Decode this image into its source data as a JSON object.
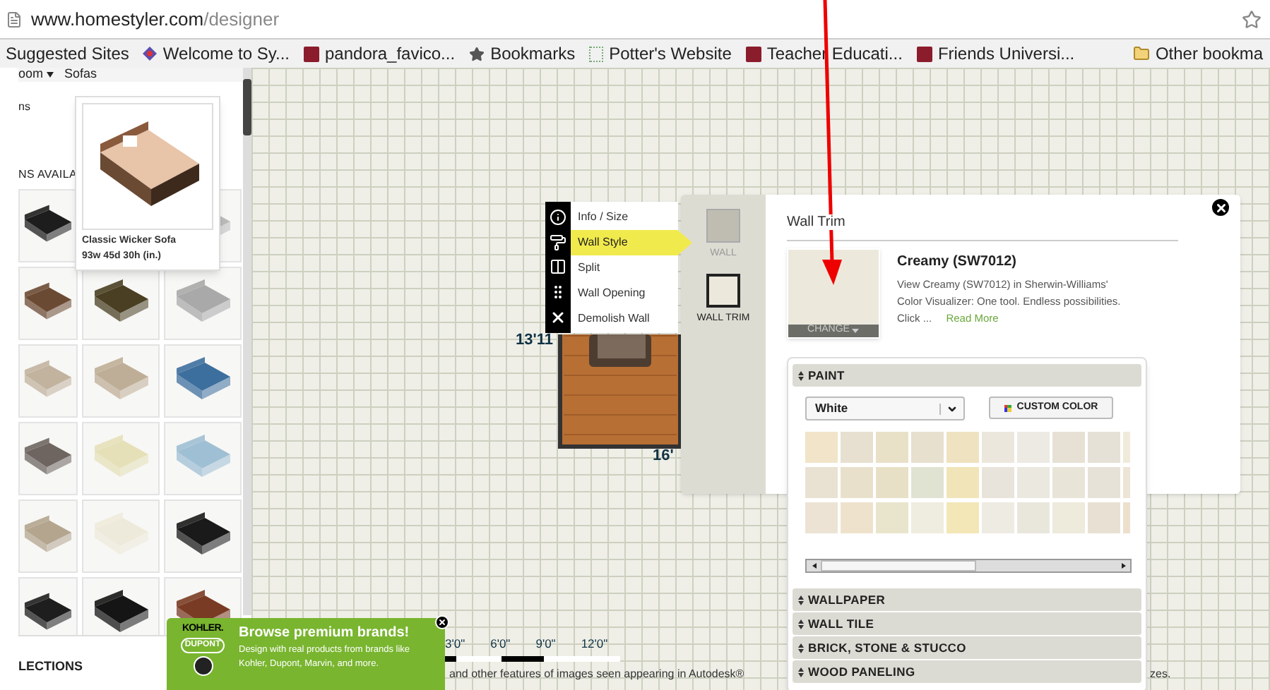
{
  "browser": {
    "url_host": "www.homestyler.com",
    "url_path": "/designer",
    "bookmarks": [
      {
        "label": "Suggested Sites",
        "kind": "plain"
      },
      {
        "label": "Welcome to Sy...",
        "kind": "site"
      },
      {
        "label": "pandora_favico...",
        "kind": "page"
      },
      {
        "label": "Bookmarks",
        "kind": "starred"
      },
      {
        "label": "Potter's Website",
        "kind": "blank"
      },
      {
        "label": "Teacher Educati...",
        "kind": "page"
      },
      {
        "label": "Friends Universi...",
        "kind": "page"
      },
      {
        "label": "Other bookma",
        "kind": "folder"
      }
    ]
  },
  "breadcrumb": [
    {
      "label": "oom",
      "dropdown": true
    },
    {
      "label": "Sofas",
      "dropdown": false
    }
  ],
  "catalog": {
    "heading": "ns",
    "subheading": "NS AVAILA",
    "footer": "LECTIONS",
    "tooltip": {
      "name": "Classic Wicker Sofa",
      "dimensions": "93w 45d 30h (in.)"
    }
  },
  "room": {
    "height_label": "13'11",
    "width_label": "16'"
  },
  "context_menu": [
    {
      "label": "Info / Size",
      "selected": false
    },
    {
      "label": "Wall Style",
      "selected": true
    },
    {
      "label": "Split",
      "selected": false
    },
    {
      "label": "Wall Opening",
      "selected": false
    },
    {
      "label": "Demolish Wall",
      "selected": false
    }
  ],
  "wall_style": [
    {
      "label": "WALL",
      "selected": false,
      "color": "#bfbcb2"
    },
    {
      "label": "WALL TRIM",
      "selected": true,
      "color": "#ece9dc"
    }
  ],
  "trim_panel": {
    "title": "Wall Trim",
    "color_name": "Creamy (SW7012)",
    "description": "View Creamy (SW7012) in Sherwin-Williams' Color Visualizer: One tool. Endless possibilities. Click ...",
    "read_more": "Read More",
    "change_button": "CHANGE"
  },
  "paint": {
    "dropdown": "White",
    "custom_color": "CUSTOM COLOR",
    "sections": [
      {
        "label": "PAINT",
        "expanded": true
      },
      {
        "label": "WALLPAPER",
        "expanded": false
      },
      {
        "label": "WALL TILE",
        "expanded": false
      },
      {
        "label": "BRICK, STONE & STUCCO",
        "expanded": false
      },
      {
        "label": "WOOD PANELING",
        "expanded": false
      }
    ],
    "swatches": [
      {
        "color": "#f1e4c8"
      },
      {
        "color": "#e7e0d0"
      },
      {
        "color": "#e9e0c8"
      },
      {
        "color": "#e7e0cf"
      },
      {
        "color": "#efe2c0"
      },
      {
        "color": "#ece7dd"
      },
      {
        "color": "#eceae3"
      },
      {
        "color": "#e7e1d5"
      },
      {
        "color": "#e6e1d6"
      },
      {
        "color": "#f0eadb"
      },
      {
        "color": "#e9e2d3"
      },
      {
        "color": "#e9e0cc"
      },
      {
        "color": "#e8e0c6"
      },
      {
        "color": "#e0e3d2"
      },
      {
        "color": "#f1e4b8"
      },
      {
        "color": "#e8e3db"
      },
      {
        "color": "#eae8df"
      },
      {
        "color": "#e9e4d8"
      },
      {
        "color": "#e7e2d8"
      },
      {
        "color": "#ece4d6"
      },
      {
        "color": "#ece3d5"
      },
      {
        "color": "#efe2cc"
      },
      {
        "color": "#e9e5cc"
      },
      {
        "color": "#efeddf"
      },
      {
        "color": "#f3e6b7"
      },
      {
        "color": "#eeebe2"
      },
      {
        "color": "#e9e7dc"
      },
      {
        "color": "#eeeadc"
      },
      {
        "color": "#e8e1d3"
      },
      {
        "color": "#ece0cc"
      }
    ]
  },
  "scale": [
    "3'0\"",
    "6'0\"",
    "9'0\"",
    "12'0\""
  ],
  "footer_text": [
    "and other features of images seen appearing in Autodesk®",
    "zes."
  ],
  "ad": {
    "logo": "KOHLER.",
    "logo_2": "DUPONT",
    "title": "Browse premium brands!",
    "body": "Design with real products from brands like Kohler, Dupont, Marvin, and more."
  }
}
